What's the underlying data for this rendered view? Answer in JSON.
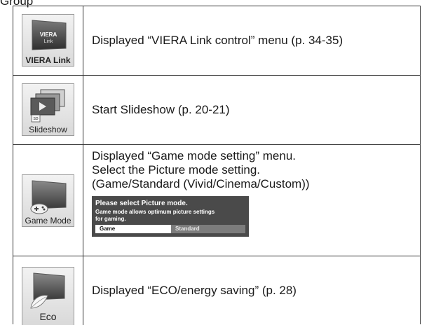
{
  "top_text": "Group",
  "rows": [
    {
      "icon": {
        "name": "viera-link-icon",
        "label": "VIERA Link"
      },
      "text": "Displayed “VIERA Link control” menu (p. 34-35)"
    },
    {
      "icon": {
        "name": "slideshow-icon",
        "label": "Slideshow"
      },
      "text": "Start Slideshow (p. 20-21)"
    },
    {
      "icon": {
        "name": "game-mode-icon",
        "label": "Game Mode"
      },
      "lines": [
        "Displayed “Game mode setting” menu.",
        "Select the Picture mode setting.",
        "(Game/Standard (Vivid/Cinema/Custom))"
      ],
      "panel": {
        "title": "Please select Picture mode.",
        "desc_line1": "Game mode allows optimum picture settings",
        "desc_line2": "for gaming.",
        "options": [
          "Game",
          "Standard"
        ],
        "selected": "Game"
      }
    },
    {
      "icon": {
        "name": "eco-icon",
        "label": "Eco"
      },
      "text": "Displayed “ECO/energy saving” (p. 28)"
    }
  ],
  "colors": {
    "panel_bg": "#4a4a4a",
    "option_unselected": "#7c7c7c",
    "border": "#333333"
  }
}
